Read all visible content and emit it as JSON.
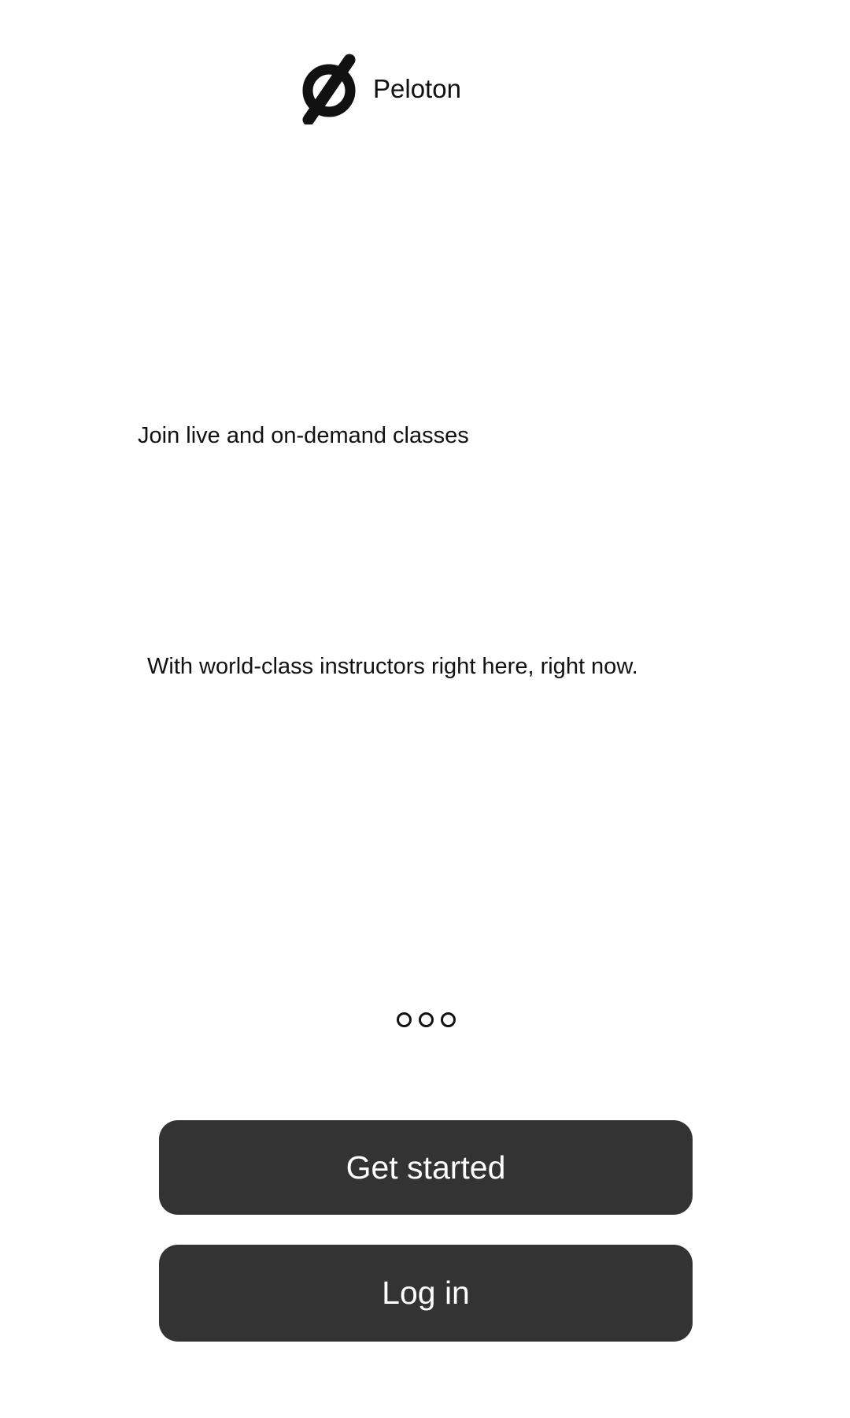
{
  "header": {
    "brand_name": "Peloton",
    "logo_icon": "peloton-logo-icon"
  },
  "hero": {
    "headline": "Join live and on-demand classes",
    "subheadline": "With world-class instructors right here, right now."
  },
  "pager": {
    "page_count": 3,
    "dots": [
      "page-dot-1",
      "page-dot-2",
      "page-dot-3"
    ]
  },
  "actions": {
    "get_started_label": "Get started",
    "log_in_label": "Log in"
  },
  "colors": {
    "background": "#ffffff",
    "button_fill": "#333333",
    "button_text": "#ffffff",
    "text": "#111111"
  }
}
